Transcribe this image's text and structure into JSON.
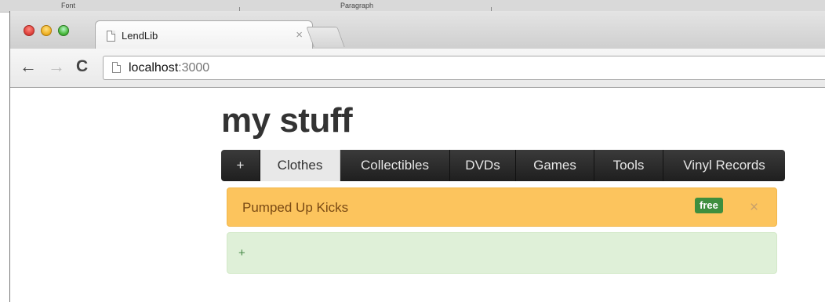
{
  "background_app": {
    "labels": [
      "Font",
      "Paragraph"
    ]
  },
  "browser": {
    "tab": {
      "title": "LendLib",
      "close_glyph": "×"
    },
    "address": {
      "host": "localhost",
      "port": ":3000"
    },
    "nav": {
      "back_glyph": "←",
      "forward_glyph": "→",
      "reload_glyph": "C"
    }
  },
  "page": {
    "title": "my stuff",
    "navbar": {
      "add_label": "+",
      "active_tab": "Clothes",
      "tabs": [
        "Clothes",
        "Collectibles",
        "DVDs",
        "Games",
        "Tools",
        "Vinyl Records"
      ]
    },
    "items": [
      {
        "name": "Pumped Up Kicks",
        "badge": "free",
        "remove_glyph": "×"
      }
    ],
    "add_item": {
      "label": "+"
    }
  },
  "colors": {
    "navbar": "#222222",
    "active_tab": "#e8e8e8",
    "item_bg": "#fcc45d",
    "badge_bg": "#3e8e3e",
    "add_bg": "#dff0d8"
  }
}
